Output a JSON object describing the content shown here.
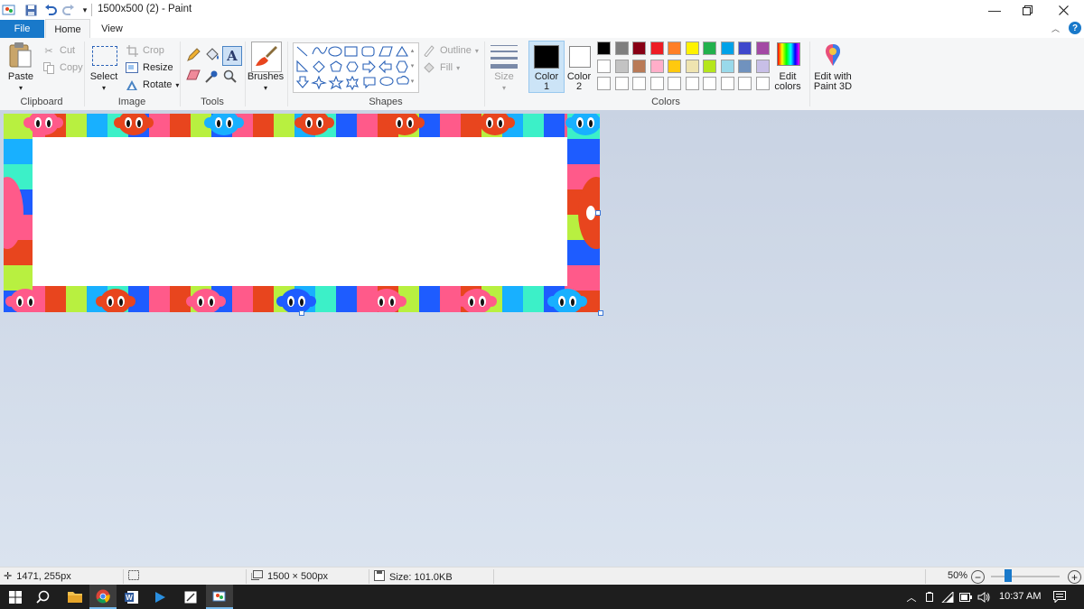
{
  "window": {
    "title": "1500x500 (2) - Paint"
  },
  "tabs": {
    "file": "File",
    "home": "Home",
    "view": "View"
  },
  "clipboard": {
    "paste": "Paste",
    "cut": "Cut",
    "copy": "Copy",
    "label": "Clipboard"
  },
  "image": {
    "select": "Select",
    "crop": "Crop",
    "resize": "Resize",
    "rotate": "Rotate",
    "label": "Image"
  },
  "tools": {
    "label": "Tools"
  },
  "brushes": {
    "label": "Brushes"
  },
  "shapes": {
    "outline": "Outline",
    "fill": "Fill",
    "label": "Shapes"
  },
  "size": {
    "label": "Size"
  },
  "colors": {
    "color1_line1": "Color",
    "color1_line2": "1",
    "color2_line1": "Color",
    "color2_line2": "2",
    "edit_line1": "Edit",
    "edit_line2": "colors",
    "label": "Colors",
    "color1_value": "#000000",
    "color2_value": "#ffffff",
    "palette": [
      "#000000",
      "#7f7f7f",
      "#880015",
      "#ed1c24",
      "#ff7f27",
      "#fff200",
      "#22b14c",
      "#00a2e8",
      "#3f48cc",
      "#a349a4",
      "#ffffff",
      "#c3c3c3",
      "#b97a57",
      "#ffaec9",
      "#ffc90e",
      "#efe4b0",
      "#b5e61d",
      "#99d9ea",
      "#7092be",
      "#c8bfe7"
    ]
  },
  "paint3d": {
    "line1": "Edit with",
    "line2": "Paint 3D"
  },
  "status": {
    "cursor_pos": "1471, 255px",
    "image_size": "1500 × 500px",
    "file_size": "Size: 101.0KB",
    "zoom": "50%",
    "zoom_level": 0.5
  },
  "taskbar": {
    "time": "10:37 AM"
  },
  "canvas": {
    "border_colors": [
      "#1e5cff",
      "#ff5a8a",
      "#e8451e",
      "#b8f040",
      "#18b0ff",
      "#3cf0c8",
      "#1e5cff",
      "#ff5a8a",
      "#e8451e",
      "#b8f040"
    ]
  }
}
